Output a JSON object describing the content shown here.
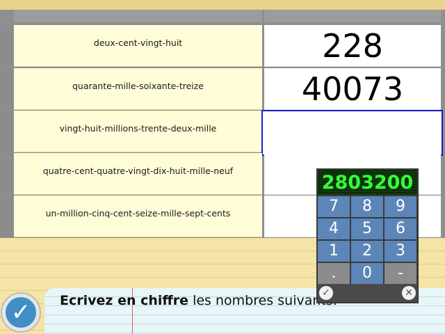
{
  "rows": [
    {
      "words": "deux-cent-vingt-huit",
      "answer": "228"
    },
    {
      "words": "quarante-mille-soixante-treize",
      "answer": "40073"
    },
    {
      "words": "vingt-huit-millions-trente-deux-mille",
      "answer": ""
    },
    {
      "words": "quatre-cent-quatre-vingt-dix-huit-mille-neuf",
      "answer": ""
    },
    {
      "words": "un-million-cinq-cent-seize-mille-sept-cents",
      "answer": ""
    }
  ],
  "keypad": {
    "display": "2803200",
    "keys": [
      "7",
      "8",
      "9",
      "4",
      "5",
      "6",
      "1",
      "2",
      "3",
      ".",
      "0",
      "-"
    ],
    "ok_icon": "check-icon",
    "cancel_icon": "close-icon"
  },
  "instruction": {
    "bold": "Ecrivez en chiffre",
    "rest": " les nombres suivants."
  },
  "validate_icon": "check-icon",
  "colors": {
    "active_border": "#1a1ad0",
    "key_blue": "#5d86b8",
    "display_green": "#33ff33"
  }
}
